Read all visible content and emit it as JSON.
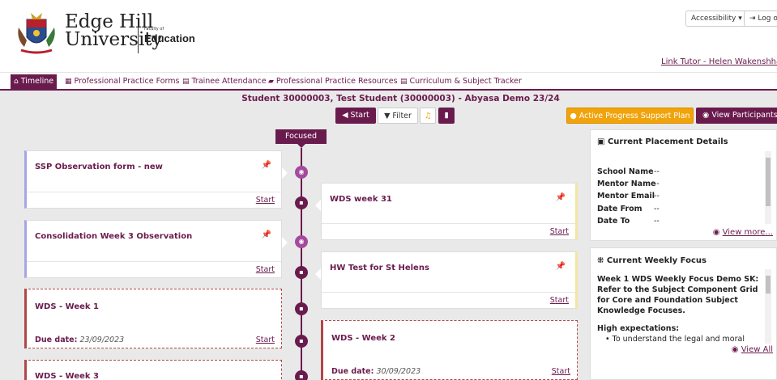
{
  "header": {
    "logo_line1": "Edge Hill",
    "logo_line2": "University",
    "faculty_small": "Faculty of",
    "faculty_big": "Education",
    "accessibility": "Accessibility ▾",
    "logout": "⇥ Log out",
    "link_tutor": "Link Tutor - Helen Wakenshhaw"
  },
  "nav": {
    "timeline": "Timeline",
    "forms": "Professional Practice Forms",
    "attendance": "Trainee Attendance",
    "resources": "Professional Practice Resources",
    "tracker": "Curriculum & Subject Tracker"
  },
  "student_title": "Student 30000003, Test Student (30000003) - Abyasa Demo 23/24",
  "toolbar": {
    "start": "Start",
    "filter": "Filter",
    "aps": "Active Progress Support Plan",
    "view_participants": "View Participants"
  },
  "focused": "Focused",
  "cards": {
    "c1_title": "SSP Observation form - new",
    "c2_title": "Consolidation Week 3 Observation",
    "c3_title": "WDS - Week 1",
    "c3_due": "23/09/2023",
    "c4_title": "WDS - Week 3",
    "r1_title": "WDS week 31",
    "r2_title": "HW Test for St Helens",
    "r3_title": "WDS - Week 2",
    "r3_due": "30/09/2023",
    "start": "Start",
    "due_label": "Due date:"
  },
  "placement": {
    "title": "Current Placement Details",
    "school_label": "School Name",
    "school_value": "--",
    "mentor_label": "Mentor Name",
    "mentor_value": "--",
    "email_label": "Mentor Email",
    "email_value": "--",
    "from_label": "Date From",
    "from_value": "--",
    "to_label": "Date To",
    "to_value": "--",
    "more": "View more..."
  },
  "weekly": {
    "title": "Current Weekly Focus",
    "body": "Week 1 WDS Weekly Focus Demo SK: Refer to the Subject Component Grid for Core and Foundation Subject Knowledge Focuses.",
    "sub": "High expectations:",
    "bullet": "To understand the legal and moral",
    "more": "View All"
  },
  "colors": {
    "brand": "#6a1b4d",
    "warning": "#f0a30a"
  }
}
